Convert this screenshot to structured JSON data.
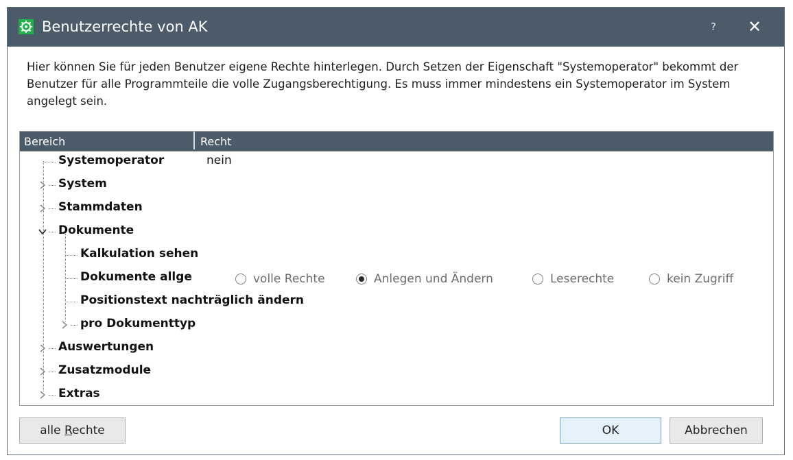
{
  "window": {
    "title": "Benutzerrechte von AK",
    "help_label": "?",
    "close_label": "✕",
    "app_icon": "app-gear-icon",
    "accent_color": "#4c5b6a"
  },
  "description": "Hier können Sie für jeden Benutzer eigene Rechte hinterlegen. Durch Setzen der Eigenschaft \"Systemoperator\" bekommt der Benutzer für alle Programmteile die volle Zugangsberechtigung. Es muss immer mindestens ein Systemoperator im System angelegt sein.",
  "grid": {
    "columns": [
      "Bereich",
      "Recht"
    ],
    "rows": [
      {
        "label": "Systemoperator",
        "value": "nein"
      },
      {
        "label": "System",
        "expand": "collapsed"
      },
      {
        "label": "Stammdaten",
        "expand": "collapsed"
      },
      {
        "label": "Dokumente",
        "expand": "expanded"
      },
      {
        "label": "Kalkulation sehen"
      },
      {
        "label": "Dokumente allge"
      },
      {
        "label": "Positionstext nachträglich ändern"
      },
      {
        "label": "pro Dokumenttyp",
        "expand": "collapsed"
      },
      {
        "label": "Auswertungen",
        "expand": "collapsed"
      },
      {
        "label": "Zusatzmodule",
        "expand": "collapsed"
      },
      {
        "label": "Extras",
        "expand": "collapsed"
      }
    ],
    "radio_options": [
      {
        "label": "volle Rechte",
        "selected": false
      },
      {
        "label": "Anlegen und Ändern",
        "selected": true
      },
      {
        "label": "Leserechte",
        "selected": false
      },
      {
        "label": "kein Zugriff",
        "selected": false
      }
    ]
  },
  "buttons": {
    "all_rights_prefix": "alle ",
    "all_rights_accel": "R",
    "all_rights_suffix": "echte",
    "ok": "OK",
    "cancel": "Abbrechen"
  }
}
